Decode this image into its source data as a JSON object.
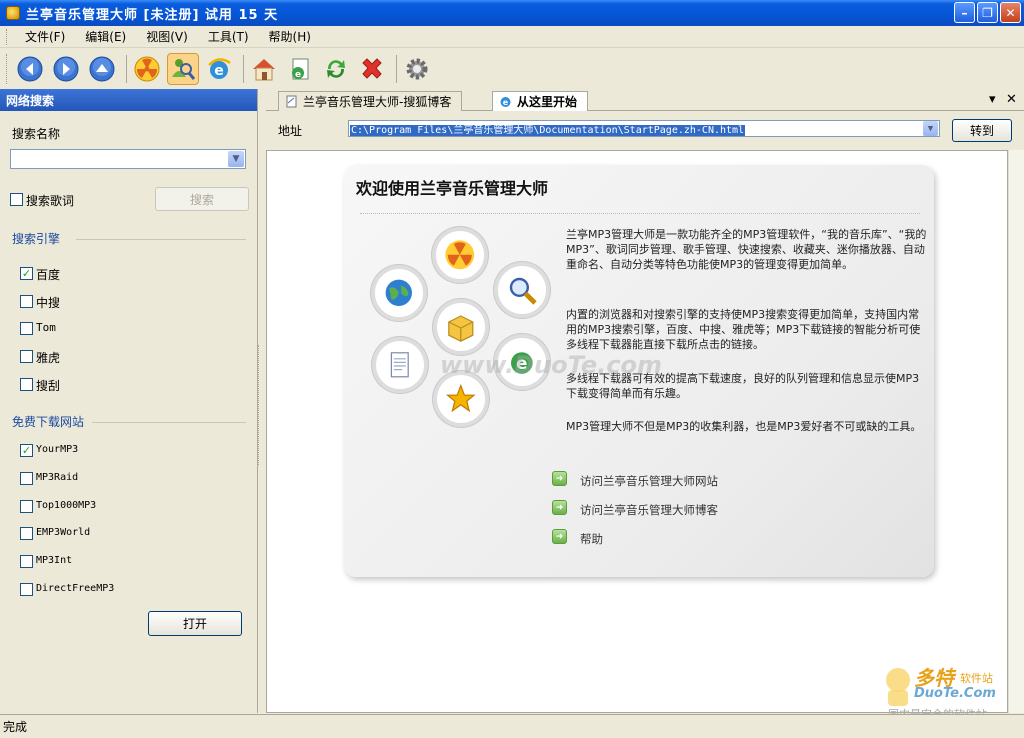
{
  "window": {
    "title": "兰亭音乐管理大师 [未注册] 试用 15 天",
    "controls": [
      "minimize",
      "maximize",
      "close"
    ]
  },
  "menu": {
    "items": [
      "文件(F)",
      "编辑(E)",
      "视图(V)",
      "工具(T)",
      "帮助(H)"
    ]
  },
  "toolbar": {
    "buttons": [
      {
        "name": "back",
        "icon": "back-arrow-icon"
      },
      {
        "name": "forward",
        "icon": "forward-arrow-icon"
      },
      {
        "name": "up",
        "icon": "up-arrow-icon"
      },
      {
        "name": "music",
        "icon": "radiation-music-icon"
      },
      {
        "name": "search",
        "icon": "search-person-icon",
        "active": true
      },
      {
        "name": "browser",
        "icon": "ie-icon"
      },
      {
        "name": "home",
        "icon": "home-icon"
      },
      {
        "name": "page",
        "icon": "page-icon"
      },
      {
        "name": "refresh",
        "icon": "refresh-icon"
      },
      {
        "name": "stop",
        "icon": "red-x-icon"
      },
      {
        "name": "settings",
        "icon": "gear-icon"
      }
    ]
  },
  "left_panel": {
    "header": "网络搜索",
    "search_name_label": "搜索名称",
    "search_name_value": "",
    "search_lyrics_label": "搜索歌词",
    "search_lyrics_checked": false,
    "search_button": "搜索",
    "engines_title": "搜索引擎",
    "engines": [
      {
        "label": "百度",
        "checked": true
      },
      {
        "label": "中搜",
        "checked": false
      },
      {
        "label": "Tom",
        "checked": false
      },
      {
        "label": "雅虎",
        "checked": false
      },
      {
        "label": "搜刮",
        "checked": false
      }
    ],
    "downloads_title": "免费下载网站",
    "downloads": [
      {
        "label": "YourMP3",
        "checked": true
      },
      {
        "label": "MP3Raid",
        "checked": false
      },
      {
        "label": "Top1000MP3",
        "checked": false
      },
      {
        "label": "EMP3World",
        "checked": false
      },
      {
        "label": "MP3Int",
        "checked": false
      },
      {
        "label": "DirectFreeMP3",
        "checked": false
      }
    ],
    "open_button": "打开"
  },
  "tabs": [
    {
      "label": "兰亭音乐管理大师-搜狐博客",
      "active": false
    },
    {
      "label": "从这里开始",
      "active": true
    }
  ],
  "address": {
    "label": "地址",
    "value": "C:\\Program Files\\兰亭音乐管理大师\\Documentation\\StartPage.zh-CN.html",
    "go_button": "转到"
  },
  "page": {
    "title": "欢迎使用兰亭音乐管理大师",
    "paragraphs": [
      "兰亭MP3管理大师是一款功能齐全的MP3管理软件，“我的音乐库”、“我的MP3”、歌词同步管理、歌手管理、快速搜索、收藏夹、迷你播放器、自动重命名、自动分类等特色功能使MP3的管理变得更加简单。",
      "内置的浏览器和对搜索引擎的支持使MP3搜索变得更加简单，支持国内常用的MP3搜索引擎，百度、中搜、雅虎等；MP3下载链接的智能分析可使多线程下载器能直接下载所点击的链接。",
      "多线程下载器可有效的提高下载速度，良好的队列管理和信息显示使MP3下载变得简单而有乐趣。",
      "MP3管理大师不但是MP3的收集利器，也是MP3爱好者不可或缺的工具。"
    ],
    "links": [
      "访问兰亭音乐管理大师网站",
      "访问兰亭音乐管理大师博客",
      "帮助"
    ],
    "watermark": "www.DuoTe.com"
  },
  "corner_logo": {
    "brand": "多特",
    "brand_sub": "软件站",
    "domain": "DuoTe.Com",
    "slogan": "国内最安全的软件站"
  },
  "status": {
    "text": "完成"
  }
}
